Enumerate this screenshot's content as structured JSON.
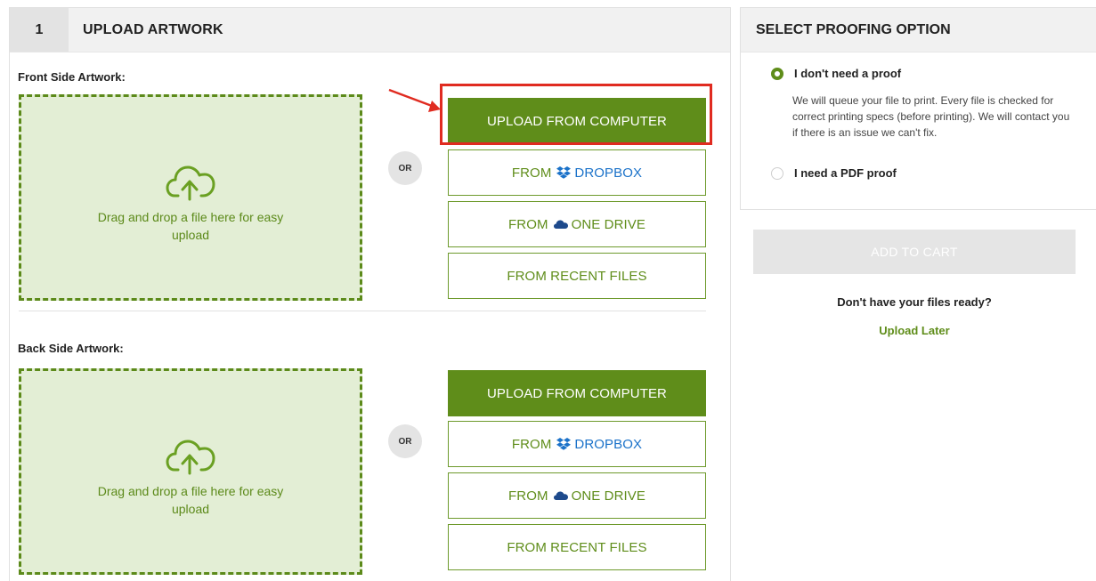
{
  "upload_panel": {
    "step_number": "1",
    "title": "UPLOAD ARTWORK",
    "front": {
      "label": "Front Side Artwork:",
      "dropzone_text": "Drag and drop a file here for easy upload",
      "or_label": "OR",
      "upload_computer": "UPLOAD FROM COMPUTER",
      "from_label": "FROM",
      "dropbox_label": "DROPBOX",
      "onedrive_label": "ONE DRIVE",
      "recent_files": "FROM RECENT FILES"
    },
    "back": {
      "label": "Back Side Artwork:",
      "dropzone_text": "Drag and drop a file here for easy upload",
      "or_label": "OR",
      "upload_computer": "UPLOAD FROM COMPUTER",
      "from_label": "FROM",
      "dropbox_label": "DROPBOX",
      "onedrive_label": "ONE DRIVE",
      "recent_files": "FROM RECENT FILES"
    }
  },
  "proofing_panel": {
    "title": "SELECT PROOFING OPTION",
    "options": [
      {
        "label": "I don't need a proof",
        "selected": true,
        "description": "We will queue your file to print. Every file is checked for correct printing specs (before printing). We will contact you if there is an issue we can't fix."
      },
      {
        "label": "I need a PDF proof",
        "selected": false
      }
    ]
  },
  "cart": {
    "add_to_cart": "ADD TO CART",
    "not_ready_text": "Don't have your files ready?",
    "upload_later": "Upload Later"
  },
  "colors": {
    "brand_green": "#5f8d1a",
    "dropzone_bg": "#e3eed5",
    "dropbox_blue": "#1b72c9",
    "annotation_red": "#e02b20"
  },
  "icons": {
    "cloud_upload": "cloud-upload-icon",
    "dropbox": "dropbox-icon",
    "onedrive": "onedrive-icon",
    "annotation_arrow": "annotation-arrow-icon"
  }
}
